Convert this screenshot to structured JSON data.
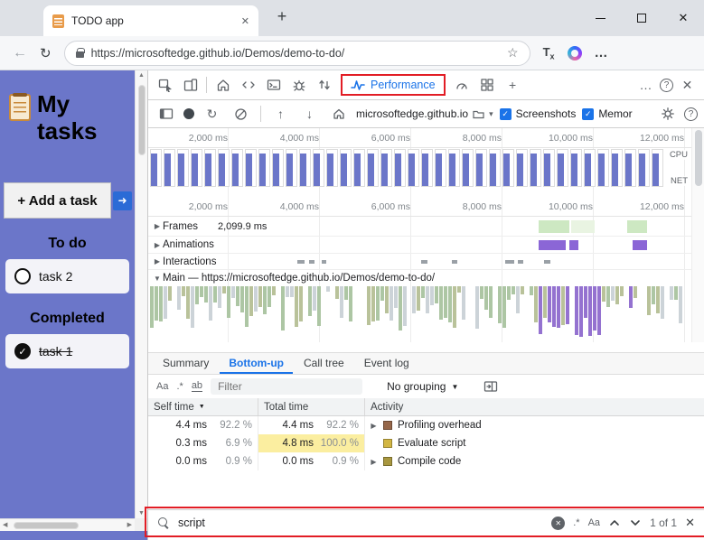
{
  "colors": {
    "accent": "#1a73e8",
    "annotation_red": "#e21d25",
    "todo_bg": "#6b76c9"
  },
  "browser": {
    "tab_title": "TODO app",
    "url": "https://microsoftedge.github.io/Demos/demo-to-do/",
    "read_aloud_label": "Tx"
  },
  "todo": {
    "title": "My tasks",
    "add_task_label": "+ Add a task",
    "todo_heading": "To do",
    "completed_heading": "Completed",
    "todo_task": "task 2",
    "completed_task": "task 1"
  },
  "devtools": {
    "performance_tab": "Performance",
    "perf_toolbar": {
      "origin": "microsoftedge.github.io",
      "screenshots": "Screenshots",
      "memory": "Memor"
    },
    "timeline": {
      "ticks": [
        "2,000 ms",
        "4,000 ms",
        "6,000 ms",
        "8,000 ms",
        "10,000 ms",
        "12,000 ms"
      ],
      "cpu": "CPU",
      "net": "NET"
    },
    "tracks": [
      {
        "arrow": "▶",
        "label": "Frames",
        "extra": "2,099.9 ms"
      },
      {
        "arrow": "▶",
        "label": "Animations",
        "extra": ""
      },
      {
        "arrow": "▶",
        "label": "Interactions",
        "extra": ""
      },
      {
        "arrow": "▼",
        "label": "Main — https://microsoftedge.github.io/Demos/demo-to-do/",
        "extra": ""
      }
    ],
    "panel_tabs": [
      {
        "label": "Summary",
        "selected": false
      },
      {
        "label": "Bottom-up",
        "selected": true
      },
      {
        "label": "Call tree",
        "selected": false
      },
      {
        "label": "Event log",
        "selected": false
      }
    ],
    "filter": {
      "placeholder": "Filter",
      "grouping": "No grouping",
      "case_icon": "Aa",
      "regex_icon": ".*",
      "word_icon": "ab"
    },
    "table": {
      "headers": {
        "self": "Self time",
        "total": "Total time",
        "activity": "Activity"
      },
      "rows": [
        {
          "self": "4.4 ms",
          "self_pct": "92.2 %",
          "total": "4.4 ms",
          "total_pct": "92.2 %",
          "activity": "Profiling overhead",
          "expand": true,
          "color": "#96674a",
          "highlight": false
        },
        {
          "self": "0.3 ms",
          "self_pct": "6.9 %",
          "total": "4.8 ms",
          "total_pct": "100.0 %",
          "activity": "Evaluate script",
          "expand": false,
          "color": "#d2b643",
          "highlight": true
        },
        {
          "self": "0.0 ms",
          "self_pct": "0.9 %",
          "total": "0.0 ms",
          "total_pct": "0.9 %",
          "activity": "Compile code",
          "expand": true,
          "color": "#a8973f",
          "highlight": false
        }
      ]
    },
    "search": {
      "value": "script",
      "count": "1 of 1",
      "regex_icon": ".*",
      "case_icon": "Aa"
    }
  }
}
